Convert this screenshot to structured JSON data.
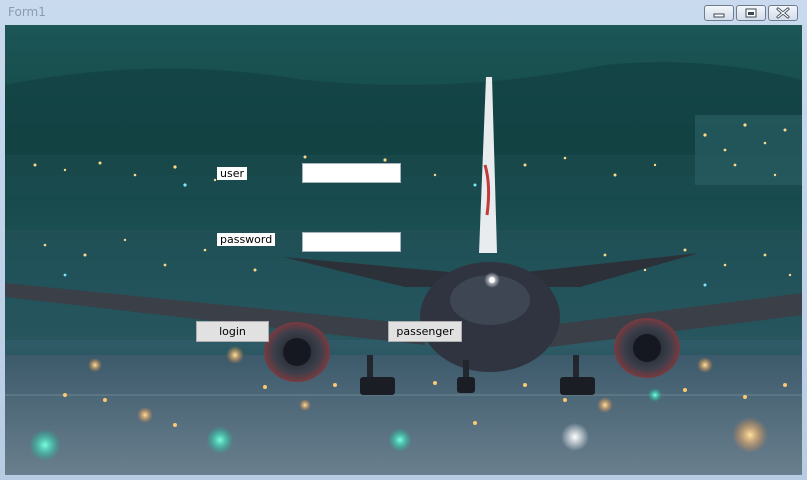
{
  "window": {
    "title": "Form1"
  },
  "form": {
    "user_label": "user",
    "user_value": "",
    "password_label": "password",
    "password_value": "",
    "login_label": "login",
    "passenger_label": "passenger"
  },
  "colors": {
    "titlebar": "#c9daee",
    "button_face": "#e1e1e1",
    "button_border": "#adadad"
  },
  "icons": [
    "minimize-icon",
    "maximize-icon",
    "close-icon"
  ]
}
